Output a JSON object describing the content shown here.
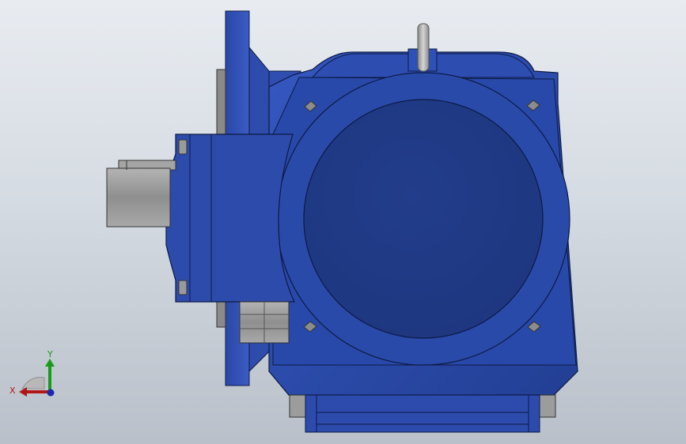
{
  "colors": {
    "body_blue": "#2b4aa8",
    "body_blue_dark": "#1f3a8a",
    "cover_blue": "#233d8c",
    "metal_gray": "#9a9a9a",
    "metal_light": "#c9c9c9",
    "background_top": "#e8ecf1",
    "background_bottom": "#b9c0c9",
    "axis_x": "#b01818",
    "axis_y": "#1a9a1a",
    "axis_z": "#1a2ab0"
  },
  "triad": {
    "x_label": "X",
    "y_label": "Y"
  }
}
